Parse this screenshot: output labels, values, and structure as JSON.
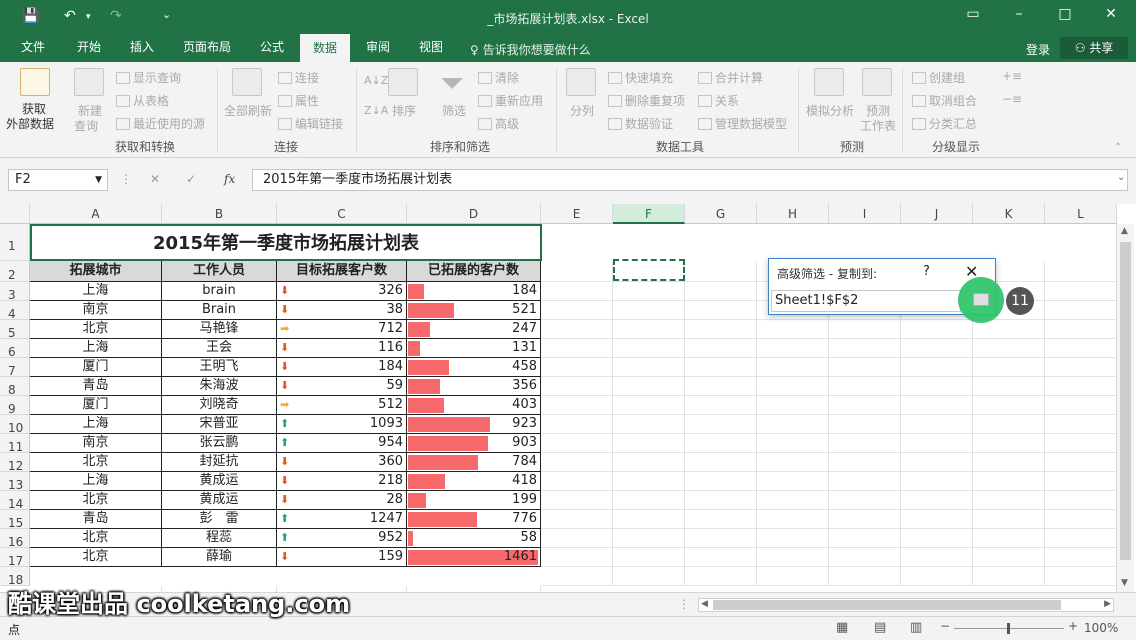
{
  "window": {
    "title": "_市场拓展计划表.xlsx - Excel"
  },
  "tabs": [
    "文件",
    "开始",
    "插入",
    "页面布局",
    "公式",
    "数据",
    "审阅",
    "视图"
  ],
  "active_tab": "数据",
  "tell_me": "告诉我你想要做什么",
  "account": {
    "login": "登录",
    "share": "共享"
  },
  "ribbon": {
    "get_external": "获取",
    "get_external2": "外部数据",
    "new_query": "新建",
    "new_query2": "查询",
    "show_queries": "显示查询",
    "from_table": "从表格",
    "recent_sources": "最近使用的源",
    "refresh_all": "全部刷新",
    "connections": "连接",
    "properties": "属性",
    "edit_links": "编辑链接",
    "sort_az": "A↓Z",
    "sort": "排序",
    "filter": "筛选",
    "clear": "清除",
    "reapply": "重新应用",
    "advanced": "高级",
    "split": "分列",
    "flash_fill": "快速填充",
    "remove_dup": "删除重复项",
    "data_validation": "数据验证",
    "consolidate": "合并计算",
    "relationships": "关系",
    "manage_model": "管理数据模型",
    "what_if": "模拟分析",
    "forecast": "预测",
    "forecast2": "工作表",
    "group": "创建组",
    "ungroup": "取消组合",
    "subtotal": "分类汇总",
    "groups": [
      "获取和转换",
      "连接",
      "排序和筛选",
      "数据工具",
      "预测",
      "分级显示"
    ]
  },
  "formula_bar": {
    "name_box": "F2",
    "cancel": "✕",
    "enter": "✓",
    "fx": "fx",
    "formula": "2015年第一季度市场拓展计划表"
  },
  "columns": [
    "A",
    "B",
    "C",
    "D",
    "E",
    "F",
    "G",
    "H",
    "I",
    "J",
    "K",
    "L"
  ],
  "rows": [
    "1",
    "2",
    "3",
    "4",
    "5",
    "6",
    "7",
    "8",
    "9",
    "10",
    "11",
    "12",
    "13",
    "14",
    "15",
    "16",
    "17",
    "18"
  ],
  "sheet": {
    "title": "2015年第一季度市场拓展计划表",
    "headers": [
      "拓展城市",
      "工作人员",
      "目标拓展客户数",
      "已拓展的客户数"
    ],
    "records": [
      {
        "city": "上海",
        "staff": "brain",
        "target": "326",
        "done": "184",
        "trend": "down",
        "done_value": 184
      },
      {
        "city": "南京",
        "staff": "Brain",
        "target": "38",
        "done": "521",
        "trend": "down",
        "done_value": 521
      },
      {
        "city": "北京",
        "staff": "马艳锋",
        "target": "712",
        "done": "247",
        "trend": "flat",
        "done_value": 247
      },
      {
        "city": "上海",
        "staff": "王会",
        "target": "116",
        "done": "131",
        "trend": "down",
        "done_value": 131
      },
      {
        "city": "厦门",
        "staff": "王明飞",
        "target": "184",
        "done": "458",
        "trend": "down",
        "done_value": 458
      },
      {
        "city": "青岛",
        "staff": "朱海波",
        "target": "59",
        "done": "356",
        "trend": "down",
        "done_value": 356
      },
      {
        "city": "厦门",
        "staff": "刘晓奇",
        "target": "512",
        "done": "403",
        "trend": "flat",
        "done_value": 403
      },
      {
        "city": "上海",
        "staff": "宋普亚",
        "target": "1093",
        "done": "923",
        "trend": "up",
        "done_value": 923
      },
      {
        "city": "南京",
        "staff": "张云鹏",
        "target": "954",
        "done": "903",
        "trend": "up",
        "done_value": 903
      },
      {
        "city": "北京",
        "staff": "封延抗",
        "target": "360",
        "done": "784",
        "trend": "down",
        "done_value": 784
      },
      {
        "city": "上海",
        "staff": "黄成运",
        "target": "218",
        "done": "418",
        "trend": "down",
        "done_value": 418
      },
      {
        "city": "北京",
        "staff": "黄成运",
        "target": "28",
        "done": "199",
        "trend": "down",
        "done_value": 199
      },
      {
        "city": "青岛",
        "staff": "彭　雷",
        "target": "1247",
        "done": "776",
        "trend": "up",
        "done_value": 776
      },
      {
        "city": "北京",
        "staff": "程蕊",
        "target": "952",
        "done": "58",
        "trend": "up",
        "done_value": 58
      },
      {
        "city": "北京",
        "staff": "薛瑜",
        "target": "159",
        "done": "1461",
        "trend": "down",
        "done_value": 1461
      }
    ],
    "bar_max": 1461
  },
  "dialog": {
    "title": "高级筛选 - 复制到:",
    "help": "?",
    "close": "✕",
    "ref": "Sheet1!$F$2"
  },
  "step_badge": "11",
  "watermark": "酷课堂出品 coolketang.com",
  "status": {
    "mode": "点",
    "zoom": "100%"
  },
  "colors": {
    "accent": "#217346",
    "bar": "#f8696b",
    "arrow_down": "#e8531c",
    "arrow_flat": "#f0a830",
    "arrow_up": "#2e9e7a"
  }
}
